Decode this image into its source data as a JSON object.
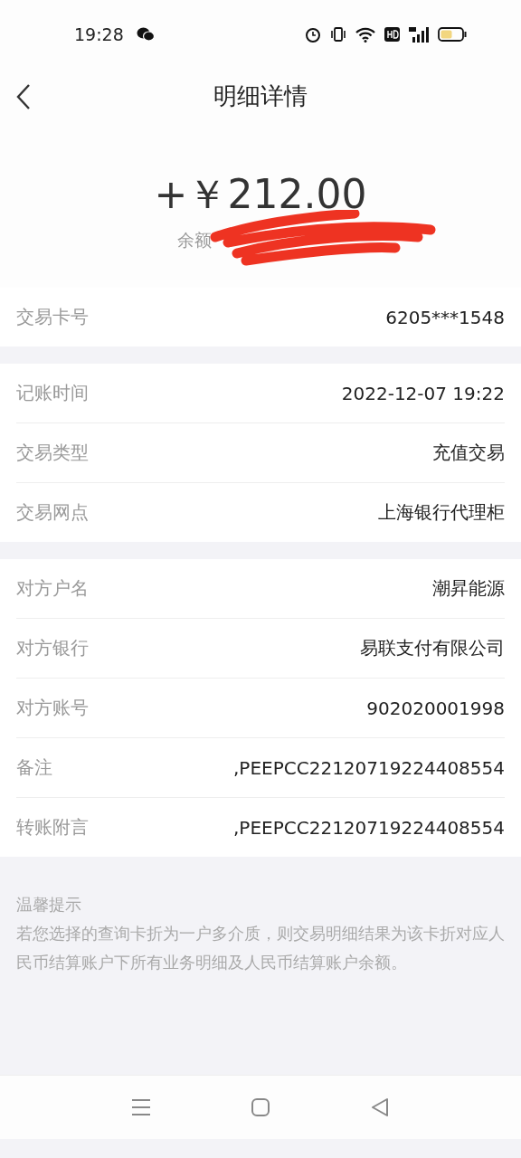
{
  "status_bar": {
    "time": "19:28"
  },
  "header": {
    "title": "明细详情"
  },
  "summary": {
    "amount": "+￥212.00",
    "balance_label": "余额",
    "redacted": true
  },
  "groups": [
    {
      "rows": [
        {
          "label": "交易卡号",
          "value": "6205***1548"
        }
      ]
    },
    {
      "rows": [
        {
          "label": "记账时间",
          "value": "2022-12-07 19:22"
        },
        {
          "label": "交易类型",
          "value": "充值交易"
        },
        {
          "label": "交易网点",
          "value": "上海银行代理柜"
        }
      ]
    },
    {
      "rows": [
        {
          "label": "对方户名",
          "value": "潮昇能源"
        },
        {
          "label": "对方银行",
          "value": "易联支付有限公司"
        },
        {
          "label": "对方账号",
          "value": "902020001998"
        },
        {
          "label": "备注",
          "value": ",PEEPCC22120719224408554"
        },
        {
          "label": "转账附言",
          "value": ",PEEPCC22120719224408554"
        }
      ]
    }
  ],
  "tip": {
    "title": "温馨提示",
    "text": "若您选择的查询卡折为一户多介质，则交易明细结果为该卡折对应人民币结算账户下所有业务明细及人民币结算账户余额。"
  }
}
